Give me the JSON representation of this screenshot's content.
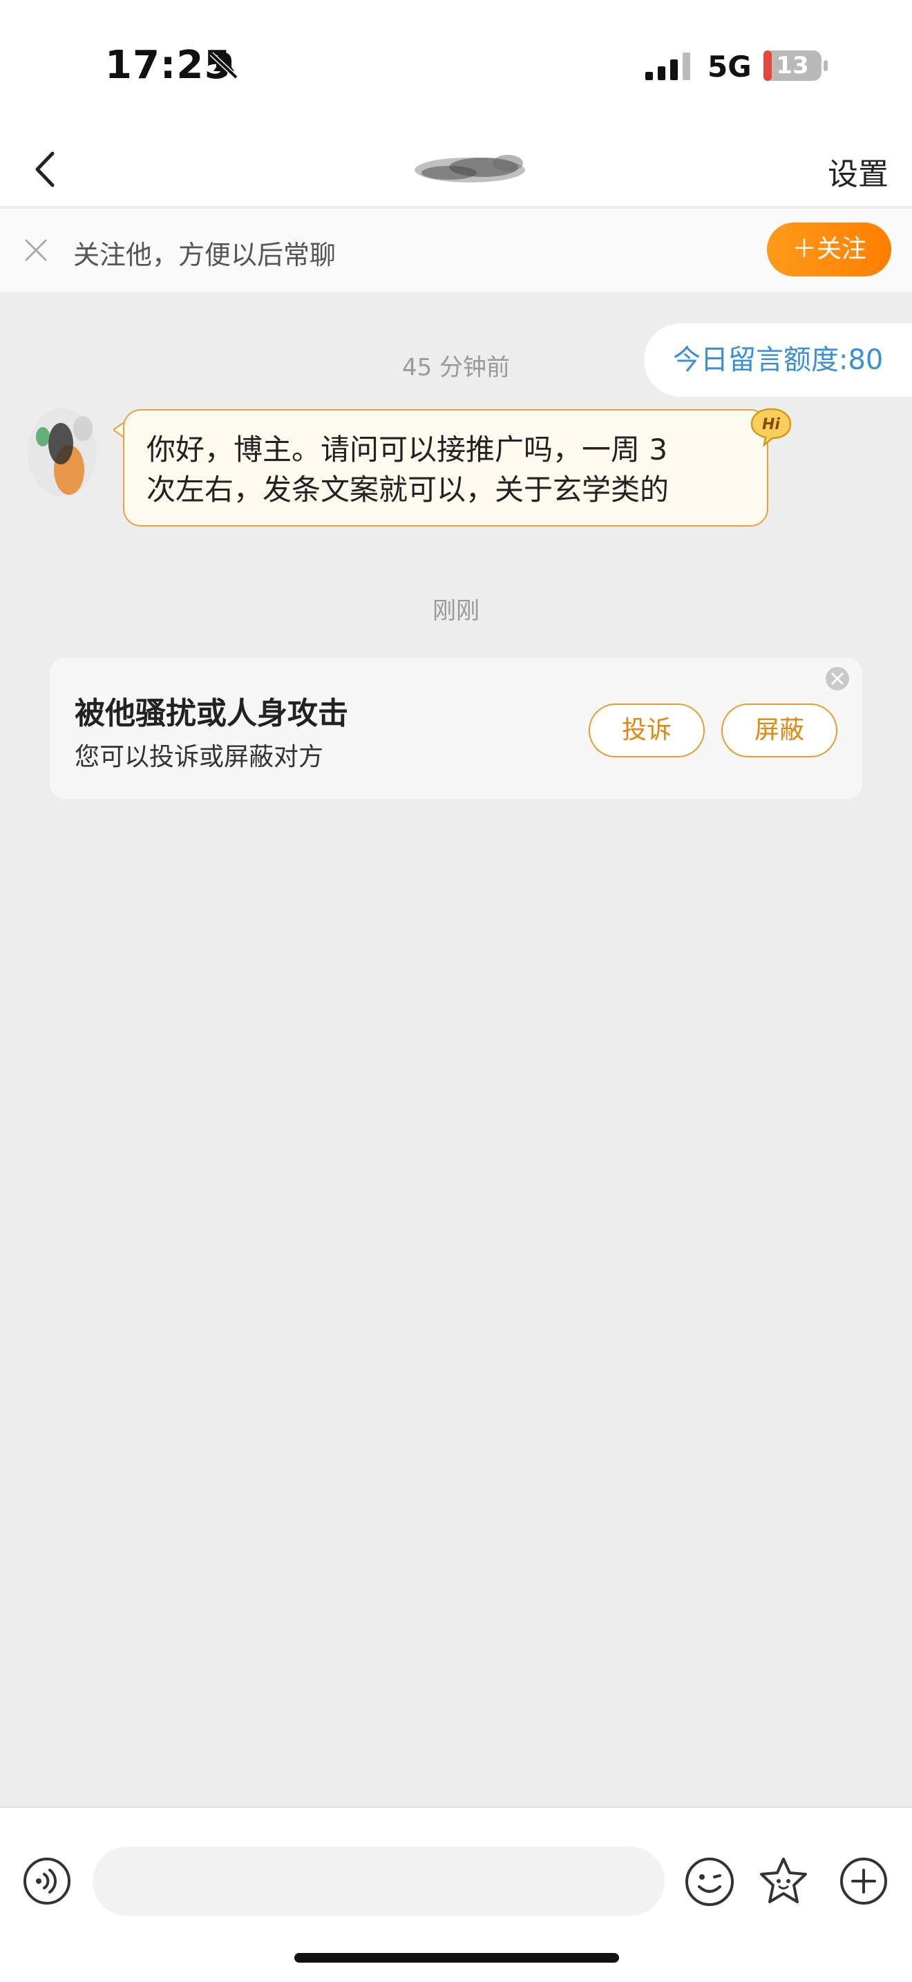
{
  "status_bar": {
    "time": "17:25",
    "network": "5G",
    "battery": "13",
    "icons": [
      "bell-mute-icon",
      "signal-icon",
      "battery-icon"
    ]
  },
  "nav": {
    "settings_label": "设置",
    "icons": [
      "back-chevron-icon"
    ]
  },
  "follow_bar": {
    "hint": "关注他，方便以后常聊",
    "follow_label": "＋关注",
    "accent": "#ff8a00"
  },
  "chat": {
    "quota_label": "今日留言额度:80",
    "timestamps": [
      "45 分钟前",
      "刚刚"
    ],
    "messages": [
      {
        "lines": [
          "你好，博主。请问可以接推广吗，一周 3",
          "次左右，发条文案就可以，关于玄学类的"
        ],
        "badge": "Hi"
      }
    ]
  },
  "harass_card": {
    "title": "被他骚扰或人身攻击",
    "subtitle": "您可以投诉或屏蔽对方",
    "report_label": "投诉",
    "block_label": "屏蔽",
    "accent": "#e99a2c"
  },
  "input_bar": {
    "placeholder": "",
    "icons": [
      "voice-icon",
      "emoji-icon",
      "sticker-icon",
      "plus-icon"
    ]
  },
  "colors": {
    "background": "#ededed",
    "link_blue": "#3a8fd9",
    "bubble_border": "#e9a23d"
  }
}
